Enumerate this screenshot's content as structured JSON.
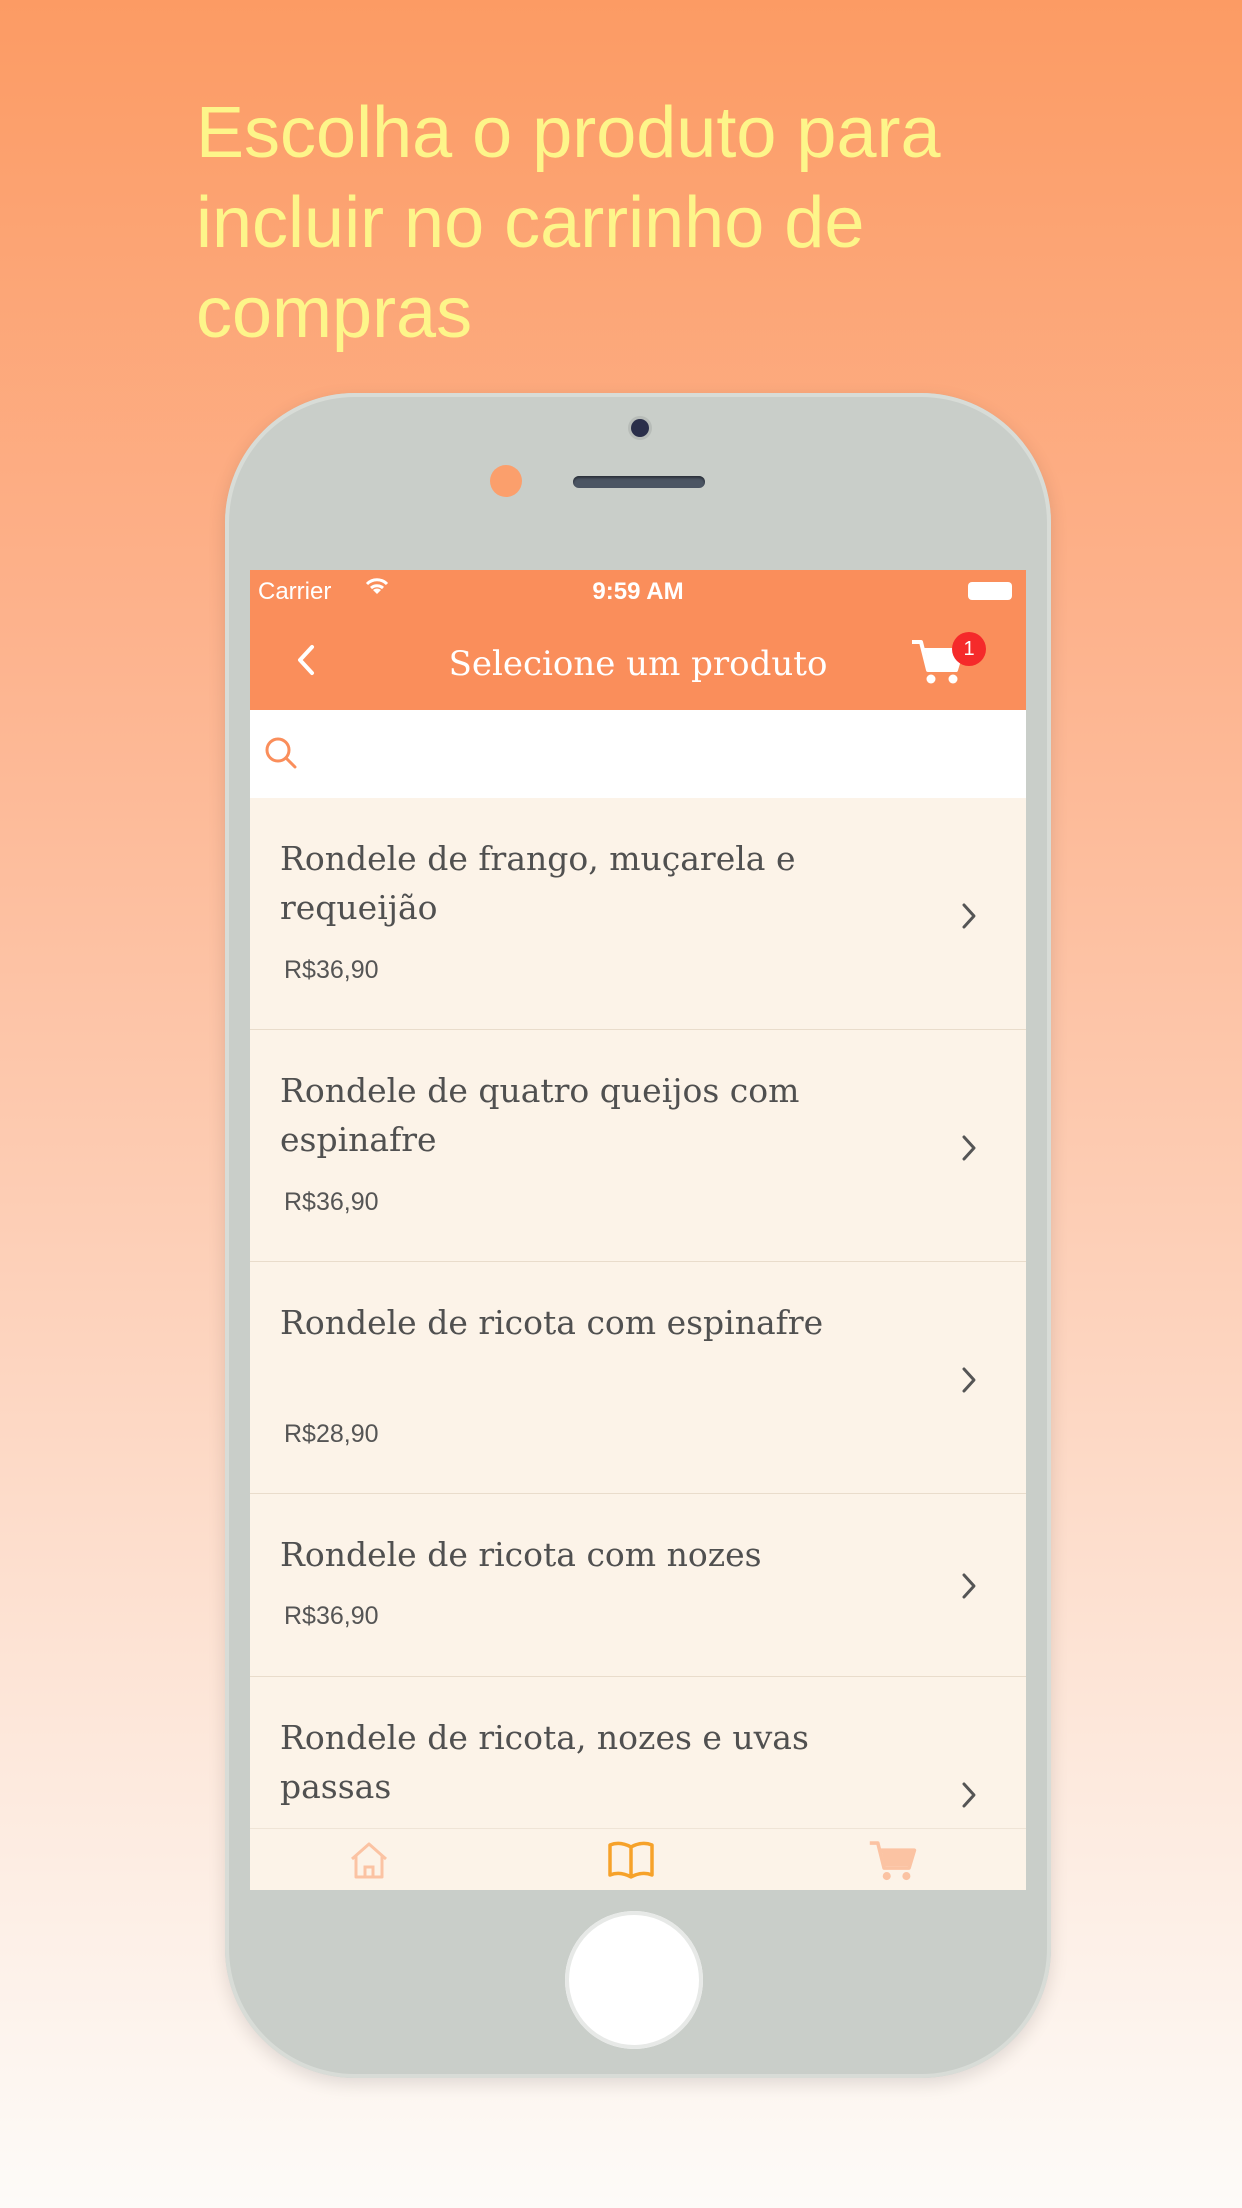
{
  "promo": {
    "headline": "Escolha o produto para incluir no carrinho de compras"
  },
  "colors": {
    "accent": "#fa8e5b",
    "headline": "#fdf58a",
    "list_bg": "#fcf3e8",
    "badge": "#f52a2a"
  },
  "status_bar": {
    "carrier": "Carrier",
    "time": "9:59 AM"
  },
  "nav": {
    "title": "Selecione um produto",
    "back_icon": "chevron-left-icon",
    "cart_icon": "cart-icon",
    "cart_badge": "1"
  },
  "search": {
    "placeholder": "",
    "value": ""
  },
  "products": [
    {
      "name": "Rondele de frango, muçarela e requeijão",
      "price": "R$36,90"
    },
    {
      "name": "Rondele de quatro queijos com espinafre",
      "price": "R$36,90"
    },
    {
      "name": "Rondele de ricota com espinafre",
      "price": "R$28,90"
    },
    {
      "name": "Rondele de ricota com nozes",
      "price": "R$36,90"
    },
    {
      "name": "Rondele de ricota, nozes e uvas passas",
      "price": ""
    }
  ],
  "tabbar": {
    "items": [
      {
        "icon": "home-icon"
      },
      {
        "icon": "book-icon",
        "active": true
      },
      {
        "icon": "cart-icon"
      }
    ]
  }
}
